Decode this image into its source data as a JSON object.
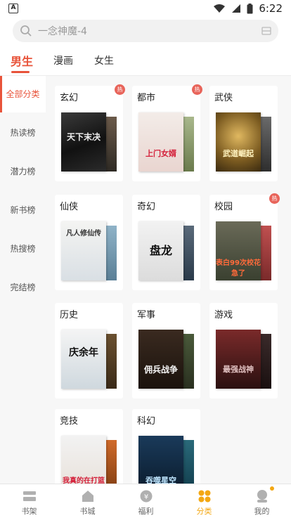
{
  "status": {
    "time": "6:22",
    "left_badge": "A"
  },
  "search": {
    "placeholder": "一念神魔-4"
  },
  "tabs": [
    {
      "label": "男生",
      "active": true
    },
    {
      "label": "漫画",
      "active": false
    },
    {
      "label": "女生",
      "active": false
    }
  ],
  "sidebar": [
    {
      "label": "全部分类",
      "active": true
    },
    {
      "label": "热读榜",
      "active": false
    },
    {
      "label": "潜力榜",
      "active": false
    },
    {
      "label": "新书榜",
      "active": false
    },
    {
      "label": "热搜榜",
      "active": false
    },
    {
      "label": "完结榜",
      "active": false
    }
  ],
  "categories": [
    {
      "name": "玄幻",
      "hot": true,
      "hot_label": "热",
      "cover_text": "天下末决"
    },
    {
      "name": "都市",
      "hot": true,
      "hot_label": "热",
      "cover_text": "上门女婿"
    },
    {
      "name": "武侠",
      "hot": false,
      "cover_text": "武道崛起"
    },
    {
      "name": "仙侠",
      "hot": false,
      "cover_text": "凡人修仙传"
    },
    {
      "name": "奇幻",
      "hot": false,
      "cover_text": "盘龙"
    },
    {
      "name": "校园",
      "hot": true,
      "hot_label": "热",
      "cover_text": "表白99次校花急了"
    },
    {
      "name": "历史",
      "hot": false,
      "cover_text": "庆余年"
    },
    {
      "name": "军事",
      "hot": false,
      "cover_text": "佣兵战争"
    },
    {
      "name": "游戏",
      "hot": false,
      "cover_text": "最强战神"
    },
    {
      "name": "竞技",
      "hot": false,
      "cover_text": "我真的在打篮球"
    },
    {
      "name": "科幻",
      "hot": false,
      "cover_text": "吞噬星空"
    }
  ],
  "bottom_nav": [
    {
      "label": "书架",
      "icon": "bookshelf-icon",
      "active": false
    },
    {
      "label": "书城",
      "icon": "bookstore-icon",
      "active": false
    },
    {
      "label": "福利",
      "icon": "welfare-icon",
      "active": false
    },
    {
      "label": "分类",
      "icon": "category-icon",
      "active": true
    },
    {
      "label": "我的",
      "icon": "profile-icon",
      "active": false
    }
  ],
  "colors": {
    "accent": "#e8533a",
    "nav_active": "#f3a712",
    "hot": "#e8645a"
  }
}
